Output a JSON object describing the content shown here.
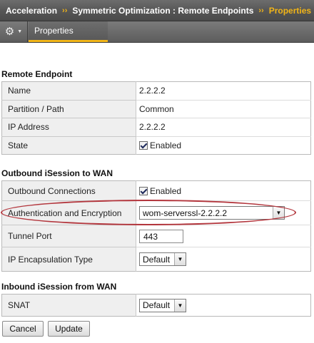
{
  "breadcrumb": {
    "items": [
      "Acceleration",
      "Symmetric Optimization : Remote Endpoints"
    ],
    "separator": "››",
    "current": "Properties"
  },
  "tabs": {
    "gear_icon": "gear-icon",
    "active_tab": "Properties"
  },
  "remote_endpoint": {
    "title": "Remote Endpoint",
    "rows": [
      {
        "label": "Name",
        "value": "2.2.2.2"
      },
      {
        "label": "Partition / Path",
        "value": "Common"
      },
      {
        "label": "IP Address",
        "value": "2.2.2.2"
      },
      {
        "label": "State",
        "value": "Enabled",
        "checked": true
      }
    ]
  },
  "outbound": {
    "title": "Outbound iSession to WAN",
    "outbound_connections": {
      "label": "Outbound Connections",
      "value": "Enabled",
      "checked": true
    },
    "auth_encryption": {
      "label": "Authentication and Encryption",
      "value": "wom-serverssl-2.2.2.2"
    },
    "tunnel_port": {
      "label": "Tunnel Port",
      "value": "443"
    },
    "ip_encapsulation": {
      "label": "IP Encapsulation Type",
      "value": "Default"
    }
  },
  "inbound": {
    "title": "Inbound iSession from WAN",
    "snat": {
      "label": "SNAT",
      "value": "Default"
    }
  },
  "buttons": {
    "cancel": "Cancel",
    "update": "Update"
  },
  "colors": {
    "accent": "#f2b517",
    "highlight": "#b3363d"
  }
}
